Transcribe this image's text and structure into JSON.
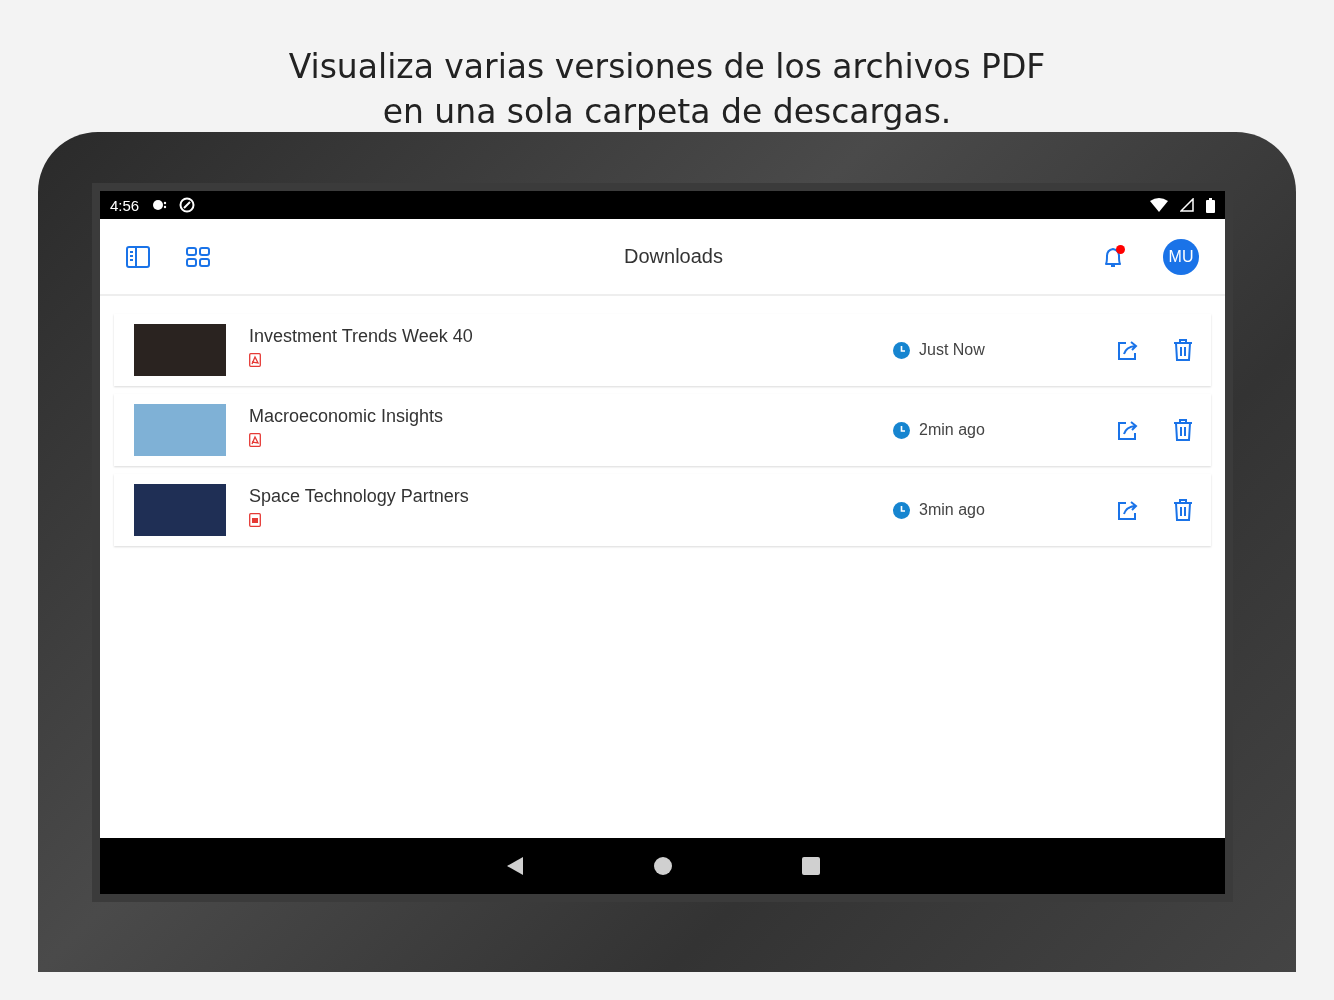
{
  "headline": [
    "Visualiza varias versiones de los archivos PDF",
    "en una sola carpeta de descargas."
  ],
  "status_bar": {
    "time": "4:56"
  },
  "app_bar": {
    "title": "Downloads",
    "notification": true,
    "avatar": "MU"
  },
  "downloads": [
    {
      "title": "Investment Trends Week 40",
      "kind": "pdf",
      "time": "Just Now",
      "color": "#2a2320"
    },
    {
      "title": "Macroeconomic Insights",
      "kind": "pdf",
      "time": "2min ago",
      "color": "#7fb1d6"
    },
    {
      "title": "Space Technology Partners",
      "kind": "slides",
      "time": "3min ago",
      "color": "#1f2f55"
    }
  ]
}
